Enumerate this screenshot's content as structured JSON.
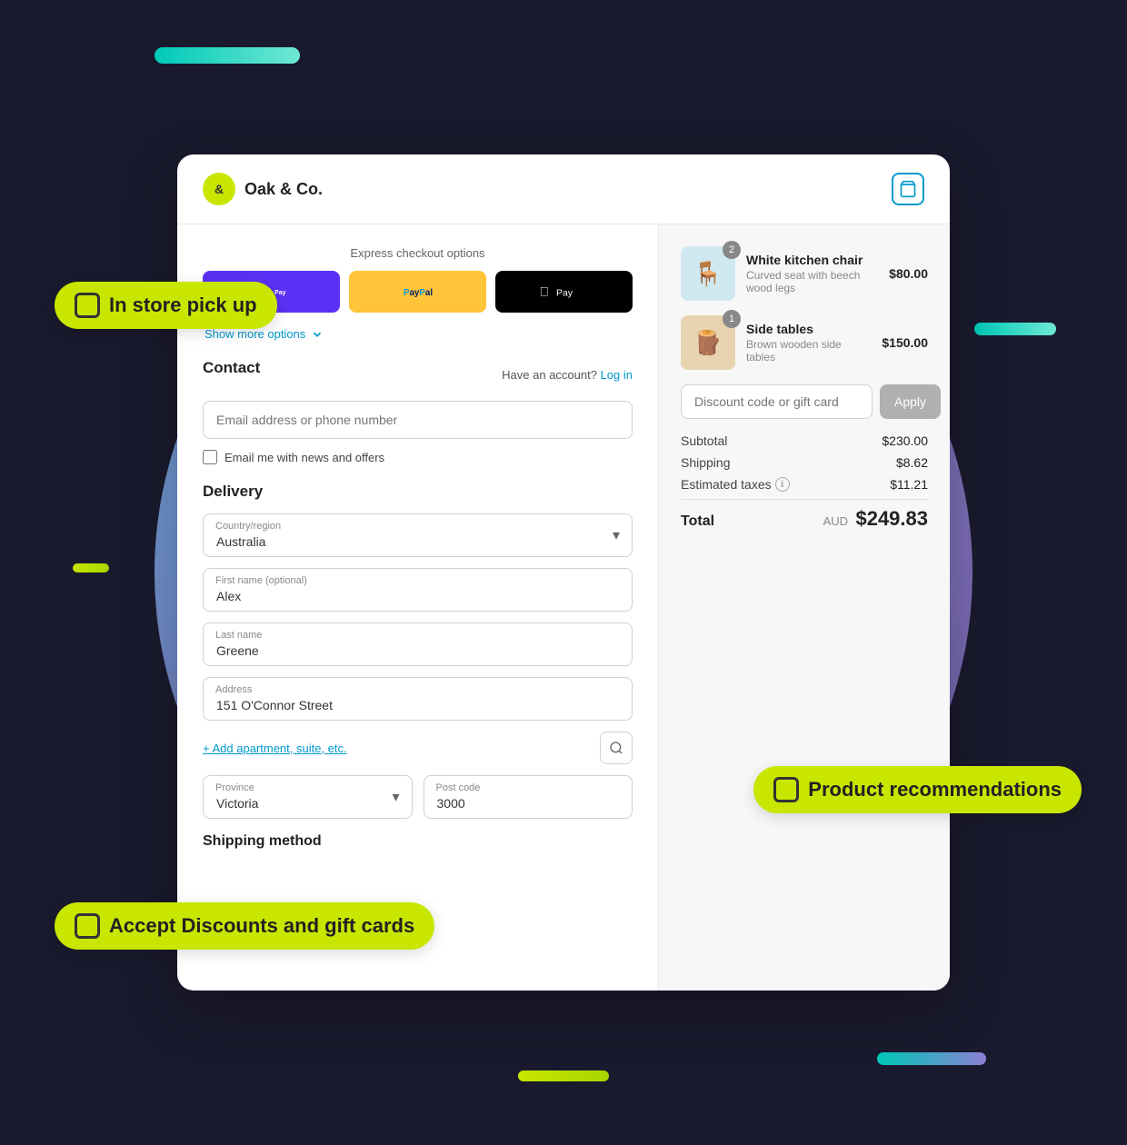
{
  "brand": {
    "logo_text": "&",
    "name": "Oak & Co."
  },
  "header": {
    "cart_label": "Cart"
  },
  "express_checkout": {
    "label": "Express checkout options",
    "shopify_label": "shop Pay",
    "paypal_label": "PayPal",
    "apple_label": "Apple Pay",
    "show_more_label": "Show more options"
  },
  "contact": {
    "title": "Contact",
    "have_account_text": "Have an account?",
    "login_label": "Log in",
    "email_placeholder": "Email address or phone number",
    "email_news_label": "Email me with news and offers"
  },
  "delivery": {
    "title": "Delivery",
    "country_label": "Country/region",
    "country_value": "Australia",
    "first_name_label": "First name (optional)",
    "first_name_value": "Alex",
    "last_name_label": "Last name",
    "last_name_value": "Greene",
    "address_label": "Address",
    "address_value": "151 O'Connor Street",
    "add_apt_label": "+ Add apartment, suite, etc.",
    "province_label": "Province",
    "province_value": "Victoria",
    "postcode_label": "Post code",
    "postcode_value": "3000",
    "shipping_method_title": "Shipping method"
  },
  "order": {
    "items": [
      {
        "name": "White kitchen chair",
        "description": "Curved seat with beech wood legs",
        "price": "$80.00",
        "badge": "2",
        "img_type": "chair"
      },
      {
        "name": "Side tables",
        "description": "Brown wooden side tables",
        "price": "$150.00",
        "badge": "1",
        "img_type": "table"
      }
    ],
    "discount_placeholder": "Discount code or gift card",
    "apply_label": "Apply",
    "subtotal_label": "Subtotal",
    "subtotal_value": "$230.00",
    "shipping_label": "Shipping",
    "shipping_value": "$8.62",
    "taxes_label": "Estimated taxes",
    "taxes_value": "$11.21",
    "total_label": "Total",
    "total_currency": "AUD",
    "total_value": "$249.83"
  },
  "badges": {
    "in_store_pickup": "In store pick up",
    "accept_discounts": "Accept Discounts and gift cards",
    "product_recommendations": "Product recommendations"
  }
}
